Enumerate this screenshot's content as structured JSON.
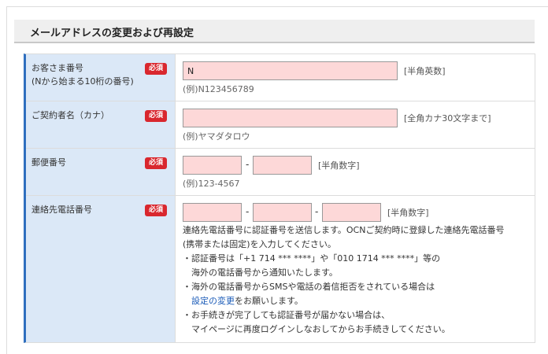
{
  "page_title": "メールアドレスの変更および再設定",
  "required_badge": "必須",
  "fields": {
    "customer_number": {
      "label_line1": "お客さま番号",
      "label_line2": "(Nから始まる10桁の番号)",
      "value": "N",
      "hint": "[半角英数]",
      "example": "(例)N123456789"
    },
    "contract_name": {
      "label": "ご契約者名（カナ）",
      "value": "",
      "hint": "[全角カナ30文字まで]",
      "example": "(例)ヤマダタロウ"
    },
    "postal_code": {
      "label": "郵便番号",
      "value1": "",
      "value2": "",
      "separator": "-",
      "hint": "[半角数字]",
      "example": "(例)123-4567"
    },
    "phone": {
      "label": "連絡先電話番号",
      "value1": "",
      "value2": "",
      "value3": "",
      "separator": "-",
      "hint": "[半角数字]",
      "notice_line1": "連絡先電話番号に認証番号を送信します。OCNご契約時に登録した連絡先電話番号",
      "notice_line2": "(携帯または固定)を入力してください。",
      "bullet1_line1": "・認証番号は「+1 714 *** ****」や「010 1714 *** ****」等の",
      "bullet1_line2": "海外の電話番号から通知いたします。",
      "bullet2_line1": "・海外の電話番号からSMSや電話の着信拒否をされている場合は",
      "bullet2_link": "設定の変更",
      "bullet2_line2_rest": "をお願いします。",
      "bullet3_line1": "・お手続きが完了しても認証番号が届かない場合は、",
      "bullet3_line2": "マイページに再度ログインしなおしてからお手続きしてください。"
    }
  }
}
